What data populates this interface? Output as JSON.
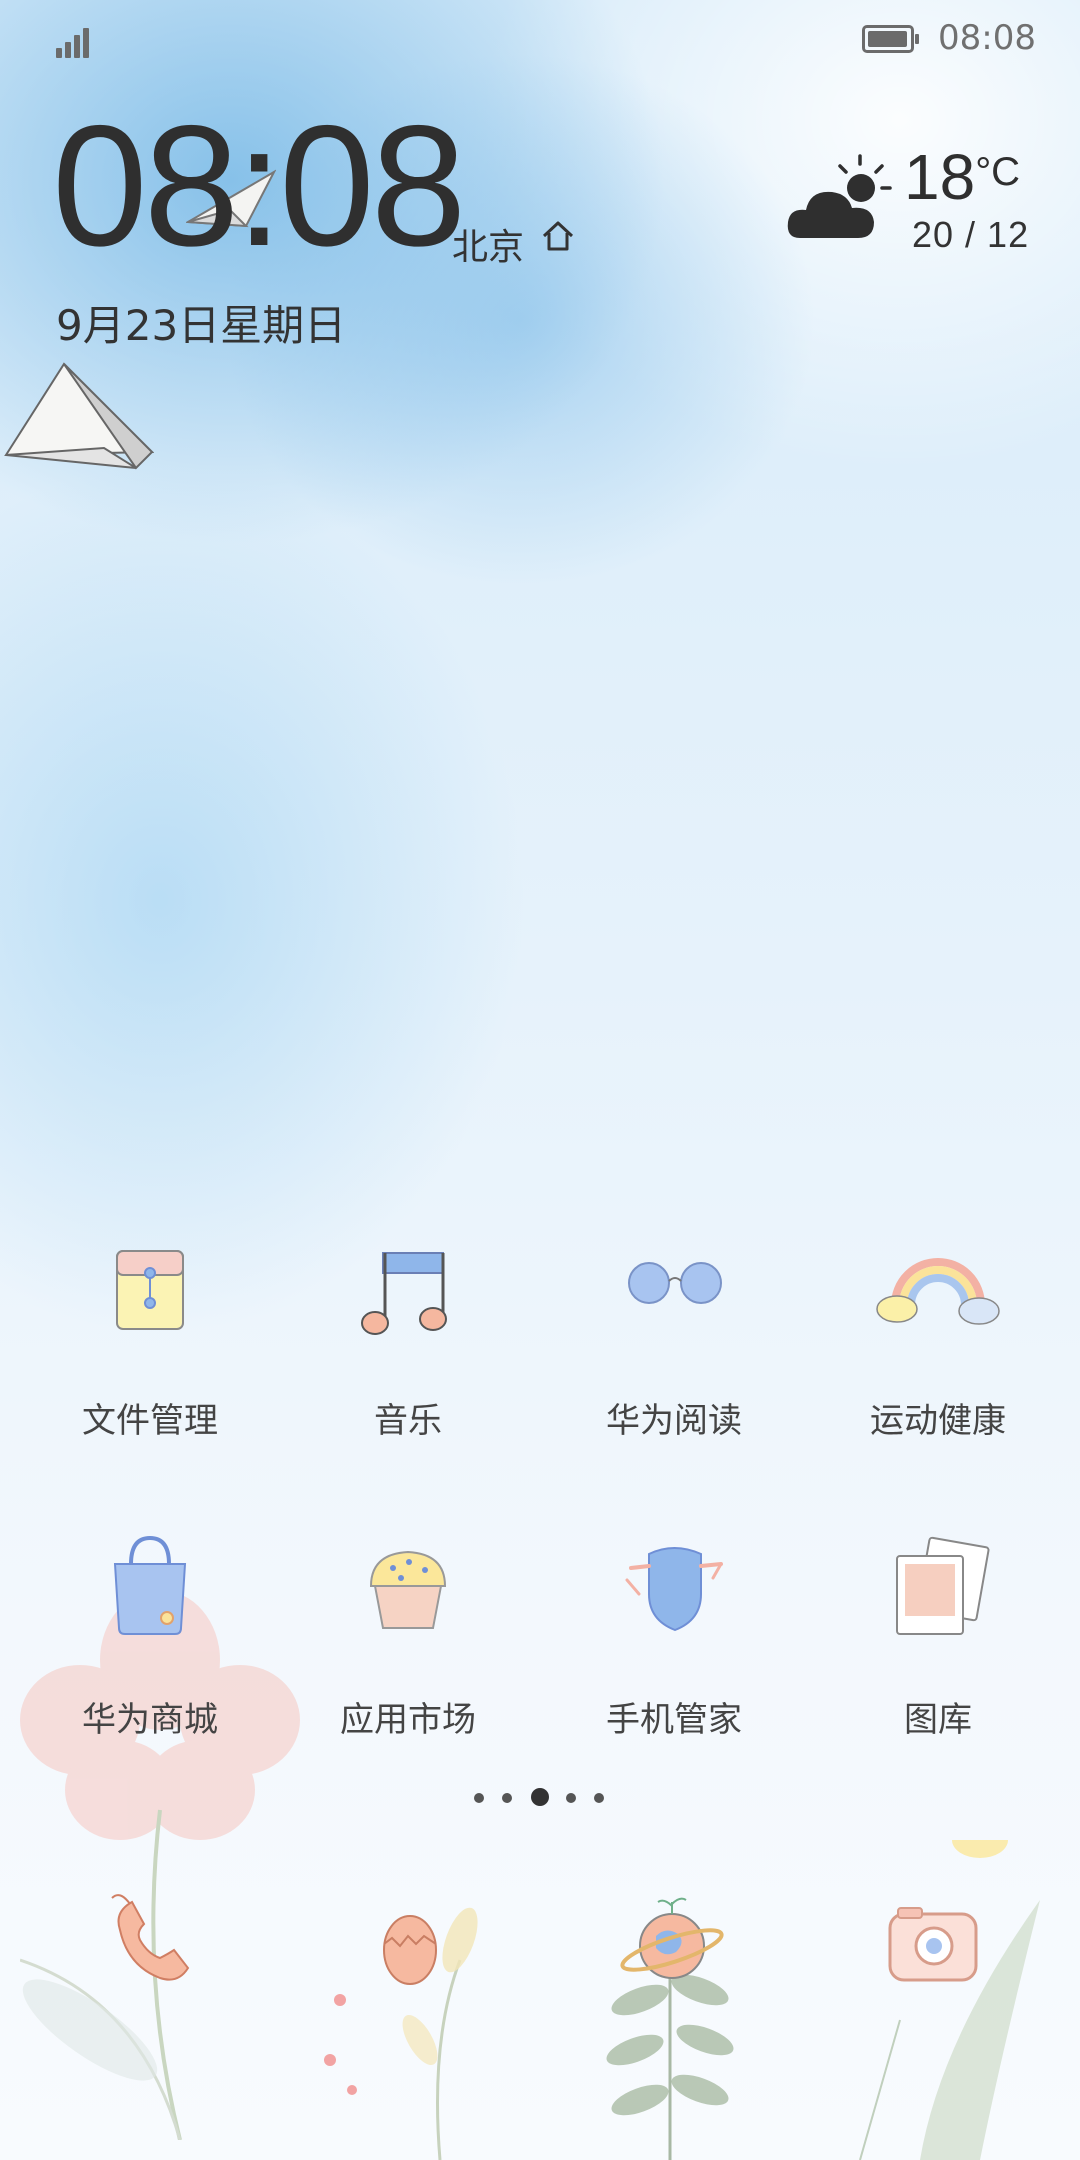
{
  "status_bar": {
    "time": "08:08",
    "battery_percent": 90
  },
  "clock_widget": {
    "time": "08:08",
    "city": "北京",
    "date": "9月23日星期日"
  },
  "weather": {
    "temp": "18",
    "unit": "°C",
    "range": "20 / 12",
    "icon": "partly-cloudy-icon"
  },
  "apps_page": [
    {
      "label": "文件管理",
      "icon": "folder-icon"
    },
    {
      "label": "音乐",
      "icon": "music-note-icon"
    },
    {
      "label": "华为阅读",
      "icon": "glasses-icon"
    },
    {
      "label": "运动健康",
      "icon": "rainbow-icon"
    },
    {
      "label": "华为商城",
      "icon": "shopping-bag-icon"
    },
    {
      "label": "应用市场",
      "icon": "cupcake-icon"
    },
    {
      "label": "手机管家",
      "icon": "shield-icon"
    },
    {
      "label": "图库",
      "icon": "photos-icon"
    }
  ],
  "page_indicator": {
    "total": 5,
    "current": 3
  },
  "dock": [
    {
      "icon": "phone-icon"
    },
    {
      "icon": "egg-icon"
    },
    {
      "icon": "planet-icon"
    },
    {
      "icon": "camera-icon"
    }
  ],
  "colors": {
    "accent_blue": "#8fb6ea",
    "accent_pink": "#f3b1a4",
    "accent_yellow": "#fbf1a6"
  }
}
